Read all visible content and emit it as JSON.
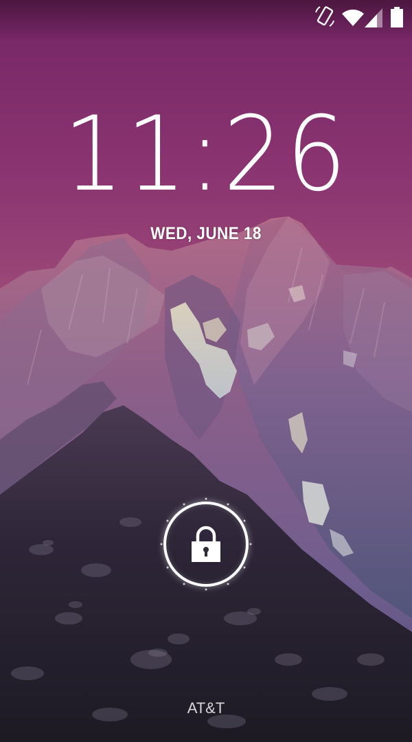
{
  "status_bar": {
    "icons": [
      "screen-rotation-icon",
      "wifi-icon",
      "cell-signal-icon",
      "battery-icon"
    ]
  },
  "lockscreen": {
    "time": "11:26",
    "date": "WED, JUNE 18",
    "carrier": "AT&T",
    "unlock_icon": "lock-icon"
  },
  "colors": {
    "sky_top": "#7a2a68",
    "sky_bottom": "#a8507c",
    "mountain_light": "#8a5a7e",
    "mountain_dark": "#2b2436",
    "text": "#ffffff"
  }
}
